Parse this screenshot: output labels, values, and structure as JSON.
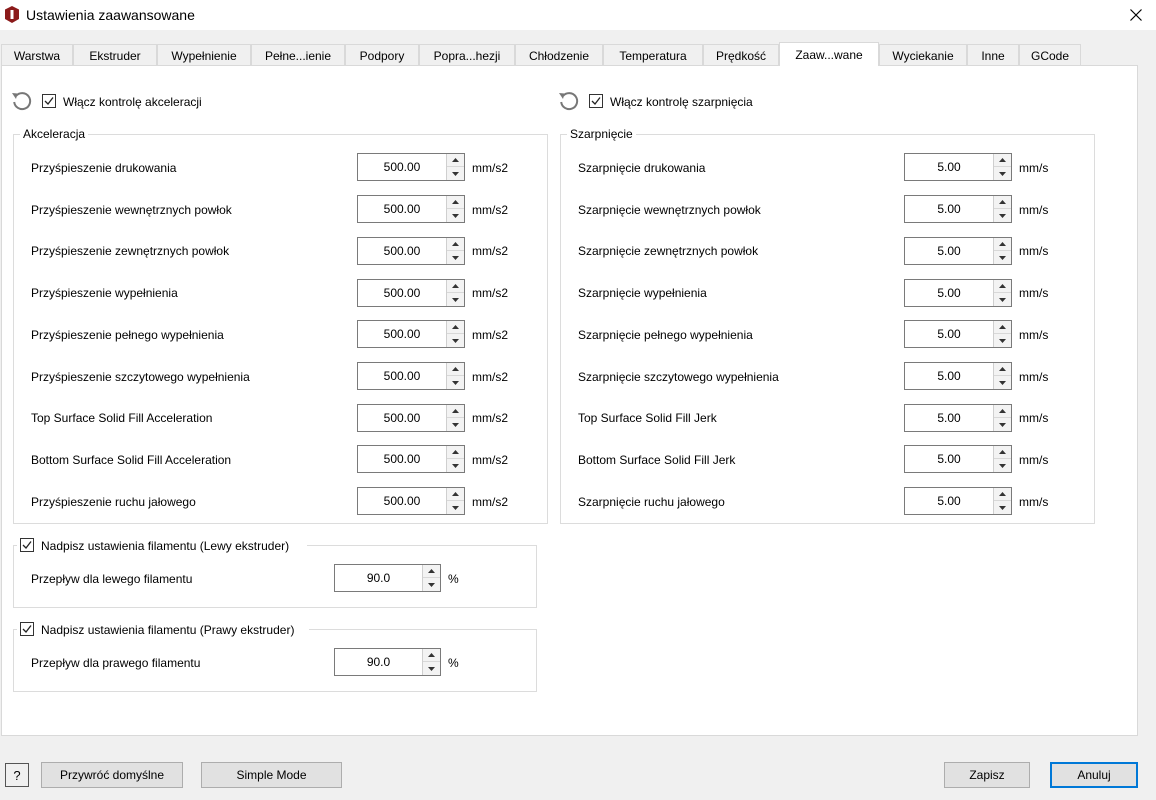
{
  "window": {
    "title": "Ustawienia zaawansowane",
    "close_icon": "close-icon"
  },
  "tabs": [
    {
      "label": "Warstwa"
    },
    {
      "label": "Ekstruder"
    },
    {
      "label": "Wypełnienie"
    },
    {
      "label": "Pełne...ienie"
    },
    {
      "label": "Podpory"
    },
    {
      "label": "Popra...hezji"
    },
    {
      "label": "Chłodzenie"
    },
    {
      "label": "Temperatura"
    },
    {
      "label": "Prędkość"
    },
    {
      "label": "Zaaw...wane",
      "active": true
    },
    {
      "label": "Wyciekanie"
    },
    {
      "label": "Inne"
    },
    {
      "label": "GCode"
    }
  ],
  "acceleration": {
    "enable_label": "Włącz kontrolę akceleracji",
    "enabled": true,
    "group_title": "Akceleracja",
    "unit": "mm/s2",
    "rows": [
      {
        "label": "Przyśpieszenie drukowania",
        "value": "500.00"
      },
      {
        "label": "Przyśpieszenie wewnętrznych powłok",
        "value": "500.00"
      },
      {
        "label": "Przyśpieszenie zewnętrznych powłok",
        "value": "500.00"
      },
      {
        "label": "Przyśpieszenie wypełnienia",
        "value": "500.00"
      },
      {
        "label": "Przyśpieszenie pełnego wypełnienia",
        "value": "500.00"
      },
      {
        "label": "Przyśpieszenie szczytowego wypełnienia",
        "value": "500.00"
      },
      {
        "label": "Top Surface Solid Fill Acceleration",
        "value": "500.00"
      },
      {
        "label": "Bottom Surface Solid Fill Acceleration",
        "value": "500.00"
      },
      {
        "label": "Przyśpieszenie ruchu jałowego",
        "value": "500.00"
      }
    ]
  },
  "jerk": {
    "enable_label": "Włącz kontrolę szarpnięcia",
    "enabled": true,
    "group_title": "Szarpnięcie",
    "unit": "mm/s",
    "rows": [
      {
        "label": "Szarpnięcie drukowania",
        "value": "5.00"
      },
      {
        "label": "Szarpnięcie wewnętrznych powłok",
        "value": "5.00"
      },
      {
        "label": "Szarpnięcie zewnętrznych powłok",
        "value": "5.00"
      },
      {
        "label": "Szarpnięcie wypełnienia",
        "value": "5.00"
      },
      {
        "label": "Szarpnięcie pełnego wypełnienia",
        "value": "5.00"
      },
      {
        "label": "Szarpnięcie szczytowego wypełnienia",
        "value": "5.00"
      },
      {
        "label": "Top Surface Solid Fill Jerk",
        "value": "5.00"
      },
      {
        "label": "Bottom Surface Solid Fill Jerk",
        "value": "5.00"
      },
      {
        "label": "Szarpnięcie ruchu jałowego",
        "value": "5.00"
      }
    ]
  },
  "left_filament": {
    "override_label": "Nadpisz ustawienia filamentu (Lewy ekstruder)",
    "checked": true,
    "flow_label": "Przepływ dla lewego filamentu",
    "flow_value": "90.0",
    "unit": "%"
  },
  "right_filament": {
    "override_label": "Nadpisz ustawienia filamentu (Prawy ekstruder)",
    "checked": true,
    "flow_label": "Przepływ dla prawego filamentu",
    "flow_value": "90.0",
    "unit": "%"
  },
  "footer": {
    "help_label": "?",
    "restore_defaults": "Przywróć domyślne",
    "simple_mode": "Simple Mode",
    "save": "Zapisz",
    "cancel": "Anuluj"
  },
  "colors": {
    "app_icon": "#8b1a1a",
    "primary_border": "#0078d7"
  }
}
